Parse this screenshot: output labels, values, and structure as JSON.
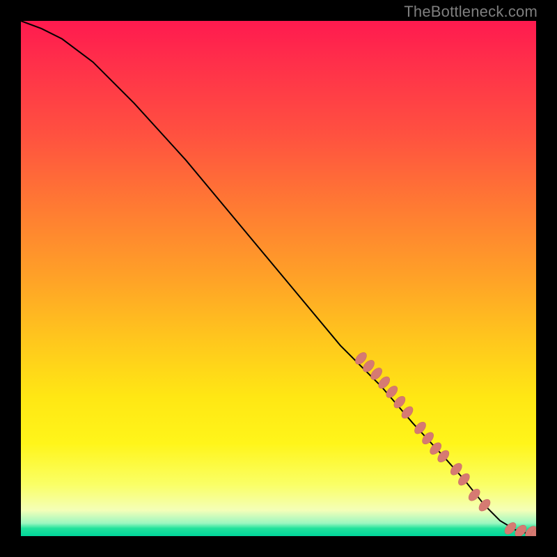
{
  "watermark": "TheBottleneck.com",
  "chart_data": {
    "type": "line",
    "title": "",
    "xlabel": "",
    "ylabel": "",
    "xlim": [
      0,
      100
    ],
    "ylim": [
      0,
      100
    ],
    "grid": false,
    "legend": false,
    "curve": [
      {
        "x": 0,
        "y": 100
      },
      {
        "x": 4,
        "y": 98.5
      },
      {
        "x": 8,
        "y": 96.5
      },
      {
        "x": 14,
        "y": 92
      },
      {
        "x": 22,
        "y": 84
      },
      {
        "x": 32,
        "y": 73
      },
      {
        "x": 42,
        "y": 61
      },
      {
        "x": 52,
        "y": 49
      },
      {
        "x": 62,
        "y": 37
      },
      {
        "x": 70,
        "y": 29
      },
      {
        "x": 76,
        "y": 22
      },
      {
        "x": 82,
        "y": 15.5
      },
      {
        "x": 86,
        "y": 11
      },
      {
        "x": 90,
        "y": 6
      },
      {
        "x": 93,
        "y": 3
      },
      {
        "x": 96,
        "y": 1.2
      },
      {
        "x": 98,
        "y": 0.6
      },
      {
        "x": 100,
        "y": 0.5
      }
    ],
    "markers": [
      {
        "x": 66,
        "y": 34.5
      },
      {
        "x": 67.5,
        "y": 33
      },
      {
        "x": 69,
        "y": 31.5
      },
      {
        "x": 70.5,
        "y": 29.8
      },
      {
        "x": 72,
        "y": 28
      },
      {
        "x": 73.5,
        "y": 26
      },
      {
        "x": 75,
        "y": 24
      },
      {
        "x": 77.5,
        "y": 21
      },
      {
        "x": 79,
        "y": 19
      },
      {
        "x": 80.5,
        "y": 17
      },
      {
        "x": 82,
        "y": 15.5
      },
      {
        "x": 84.5,
        "y": 13
      },
      {
        "x": 86,
        "y": 11
      },
      {
        "x": 88,
        "y": 8
      },
      {
        "x": 90,
        "y": 6
      },
      {
        "x": 95,
        "y": 1.5
      },
      {
        "x": 97,
        "y": 1
      },
      {
        "x": 99,
        "y": 0.8
      },
      {
        "x": 100,
        "y": 0.5
      }
    ]
  }
}
